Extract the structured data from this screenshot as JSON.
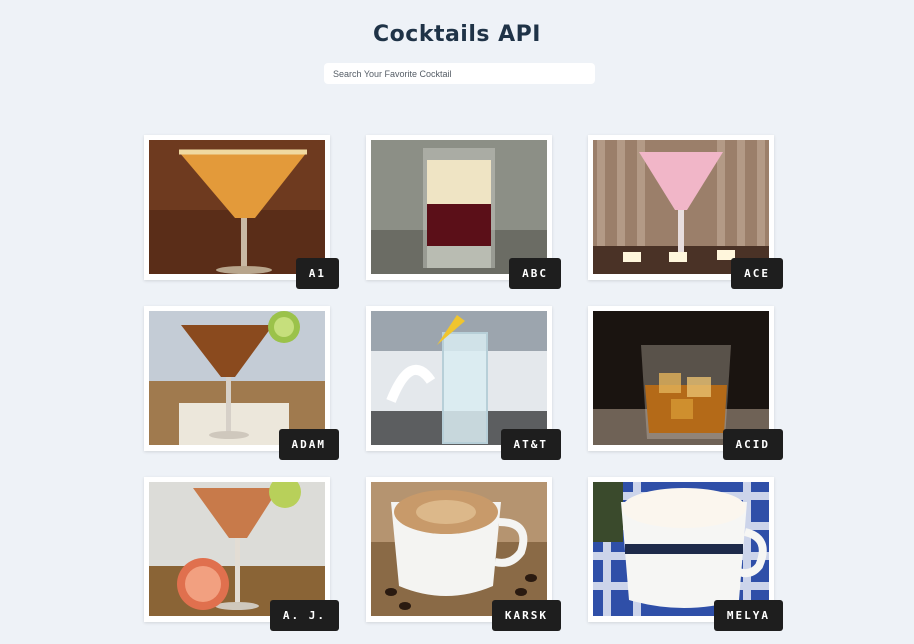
{
  "header": {
    "title": "Cocktails API"
  },
  "search": {
    "placeholder": "Search Your Favorite Cocktail",
    "value": ""
  },
  "drinks": [
    {
      "name": "A1"
    },
    {
      "name": "ABC"
    },
    {
      "name": "ACE"
    },
    {
      "name": "ADAM"
    },
    {
      "name": "AT&T"
    },
    {
      "name": "ACID"
    },
    {
      "name": "A. J."
    },
    {
      "name": "KARSK"
    },
    {
      "name": "MELYA"
    }
  ]
}
